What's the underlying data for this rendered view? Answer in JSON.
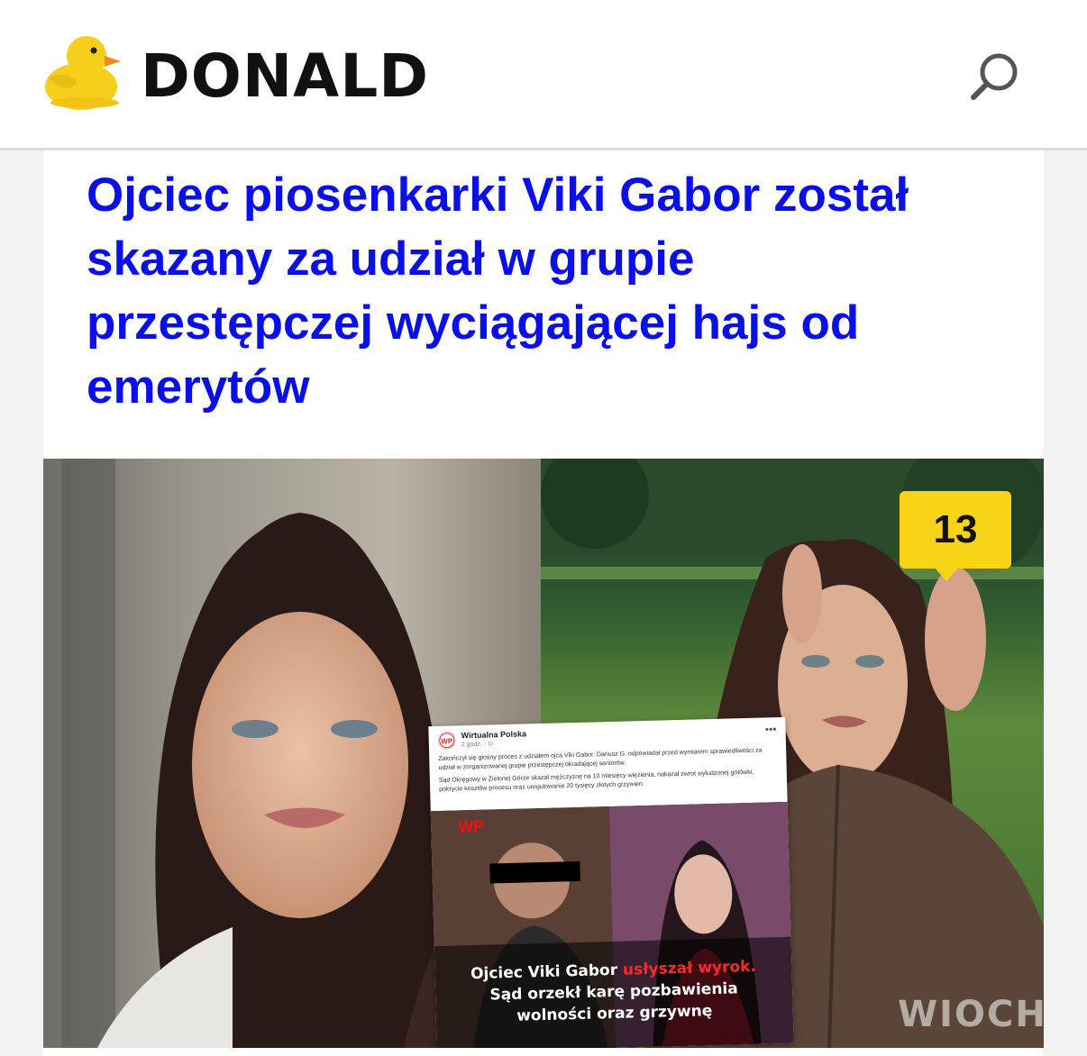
{
  "header": {
    "logo_text": "DONALD",
    "logo_icon": "duck-icon",
    "search_icon": "search-icon"
  },
  "article": {
    "headline": "Ojciec piosenkarki Viki Gabor został skazany za udział w grupie przestępczej wyciągającej hajs od emerytów",
    "comment_count": "13",
    "comment_icon": "speech-bubble-icon"
  },
  "embed": {
    "source": "Wirtualna Polska",
    "time": "2 godz. · ⊙",
    "paragraph_1": "Zakończył się głośny proces z udziałem ojca Viki Gabor. Dariusz G. odpowiadał przed wymiarem sprawiedliwości za udział w zorganizowanej grupie przestępczej okradającej seniorów.",
    "paragraph_2": "Sąd Okręgowy w Zielonej Górze skazał mężczyznę na 10 miesięcy więzienia, nakazał zwrot wyłudzonej gotówki, pokrycie kosztów procesu oraz uregulowanie 20 tysięcy złotych grzywien.",
    "caption_part1": "Ojciec Viki Gabor ",
    "caption_highlight": "usłyszał wyrok.",
    "caption_part2": " Sąd orzekł karę pozbawienia wolności oraz grzywnę",
    "media_logo": "WP"
  },
  "watermark": "WIOCHA",
  "colors": {
    "headline": "#0a10e6",
    "badge": "#f7d417",
    "caption_highlight": "#ff2a2a"
  }
}
